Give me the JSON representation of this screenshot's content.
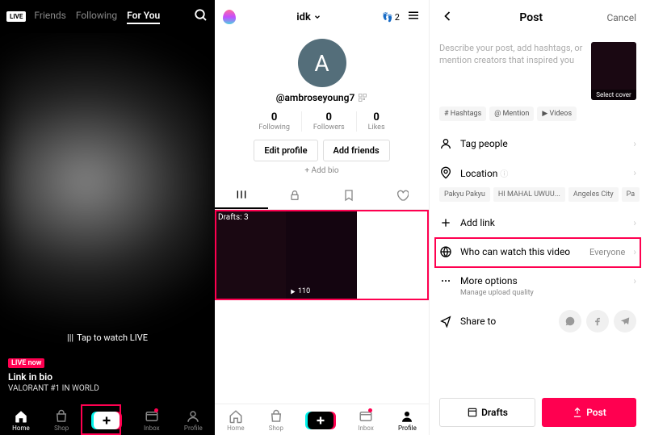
{
  "panel1": {
    "live_badge": "LIVE",
    "tabs": [
      "Friends",
      "Following",
      "For You"
    ],
    "active_tab": 2,
    "tap_live": "Tap to watch LIVE",
    "live_now": "LIVE now",
    "feed_title": "Link in bio",
    "feed_sub": "VALORANT #1 IN WORLD",
    "nav": [
      "Home",
      "Shop",
      "",
      "Inbox",
      "Profile"
    ]
  },
  "panel2": {
    "title": "idk",
    "coin": "2",
    "avatar_letter": "A",
    "username": "@ambroseyoung7",
    "stats": [
      {
        "num": "0",
        "label": "Following"
      },
      {
        "num": "0",
        "label": "Followers"
      },
      {
        "num": "0",
        "label": "Likes"
      }
    ],
    "edit_profile": "Edit profile",
    "add_friends": "Add friends",
    "add_bio": "+ Add bio",
    "drafts_label": "Drafts: 3",
    "video_views": "110",
    "nav": [
      "Home",
      "Shop",
      "",
      "Inbox",
      "Profile"
    ]
  },
  "panel3": {
    "title": "Post",
    "cancel": "Cancel",
    "desc_placeholder": "Describe your post, add hashtags, or mention creators that inspired you",
    "cover_label": "Select cover",
    "chips": [
      "# Hashtags",
      "@ Mention",
      "▶ Videos"
    ],
    "tag_people": "Tag people",
    "location": "Location",
    "loc_chips": [
      "Pakyu Pakyu",
      "HI MAHAL UWUU...",
      "Angeles City",
      "Pa"
    ],
    "add_link": "Add link",
    "privacy_label": "Who can watch this video",
    "privacy_value": "Everyone",
    "more_options": "More options",
    "more_sub": "Manage upload quality",
    "share_to": "Share to",
    "drafts_btn": "Drafts",
    "post_btn": "Post"
  }
}
